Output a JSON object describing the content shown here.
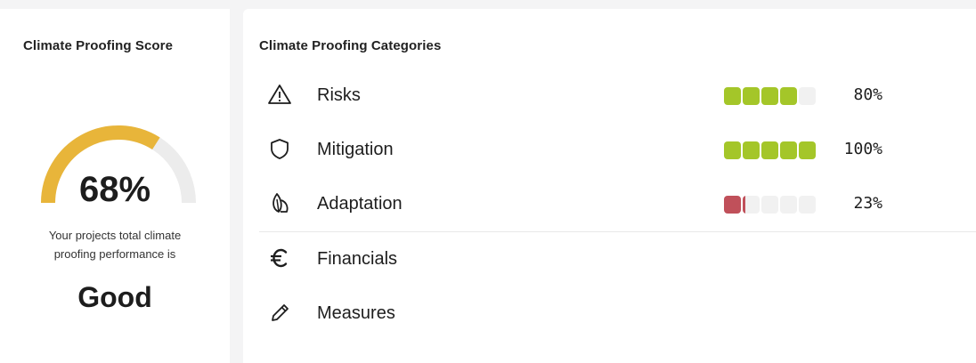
{
  "score_panel": {
    "title": "Climate Proofing Score",
    "value": "68%",
    "percent": 68,
    "desc_line1": "Your projects total climate",
    "desc_line2": "proofing performance is",
    "rating": "Good",
    "colors": {
      "gauge_fill": "#e8b53a",
      "gauge_track": "#ececec"
    }
  },
  "categories_panel": {
    "title": "Climate Proofing Categories",
    "items": [
      {
        "label": "Risks",
        "icon": "warning-triangle-icon",
        "percent": 80,
        "pct_label": "80%",
        "color": "#a4c629"
      },
      {
        "label": "Mitigation",
        "icon": "shield-icon",
        "percent": 100,
        "pct_label": "100%",
        "color": "#a4c629"
      },
      {
        "label": "Adaptation",
        "icon": "leaf-icon",
        "percent": 23,
        "pct_label": "23%",
        "color": "#c0505a"
      },
      {
        "label": "Financials",
        "icon": "euro-icon"
      },
      {
        "label": "Measures",
        "icon": "pencil-icon"
      }
    ]
  }
}
